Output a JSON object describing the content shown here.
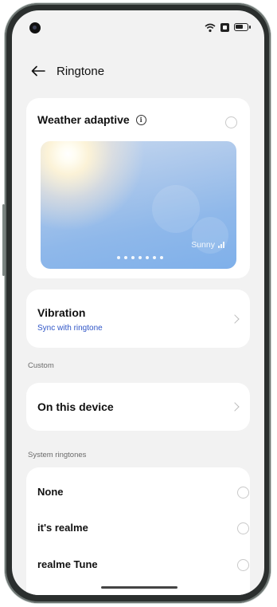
{
  "header": {
    "title": "Ringtone"
  },
  "weather": {
    "title": "Weather adaptive",
    "preview_label": "Sunny",
    "page_count": 7
  },
  "vibration": {
    "title": "Vibration",
    "subtitle": "Sync with ringtone"
  },
  "custom": {
    "section_label": "Custom",
    "device_item": "On this device"
  },
  "system_ringtones": {
    "section_label": "System ringtones",
    "items": [
      "None",
      "it's realme",
      "realme Tune"
    ]
  },
  "colors": {
    "accent_text": "#2f55c7",
    "card_bg": "#ffffff",
    "screen_bg": "#f2f2f2"
  }
}
